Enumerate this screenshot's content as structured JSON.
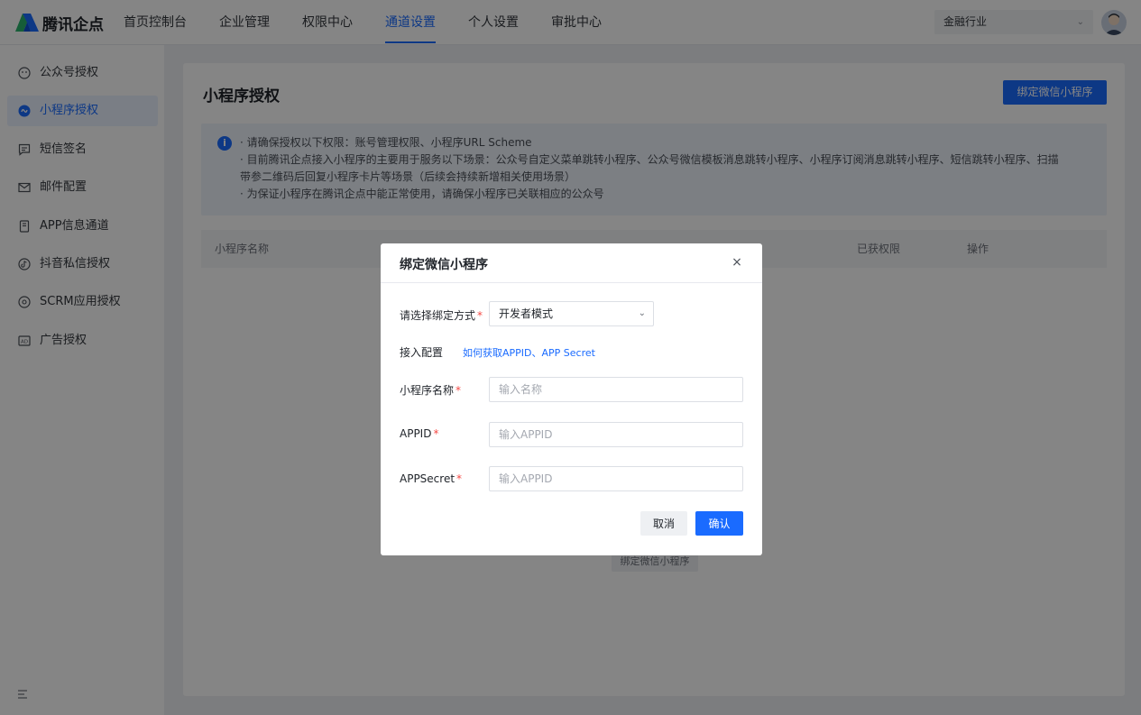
{
  "app": {
    "logo_text": "腾讯企点",
    "brand_colors": {
      "primary": "#1a6bff",
      "logo_blue": "#1a6bff",
      "logo_green": "#2bb36b"
    }
  },
  "topnav": {
    "items": [
      {
        "label": "首页控制台",
        "active": false
      },
      {
        "label": "企业管理",
        "active": false
      },
      {
        "label": "权限中心",
        "active": false
      },
      {
        "label": "通道设置",
        "active": true
      },
      {
        "label": "个人设置",
        "active": false
      },
      {
        "label": "审批中心",
        "active": false
      }
    ],
    "industry_select": {
      "value": "金融行业"
    }
  },
  "sidebar": {
    "items": [
      {
        "label": "公众号授权",
        "icon": "wechat-official-icon",
        "active": false
      },
      {
        "label": "小程序授权",
        "icon": "mini-program-icon",
        "active": true
      },
      {
        "label": "短信签名",
        "icon": "sms-icon",
        "active": false
      },
      {
        "label": "邮件配置",
        "icon": "mail-icon",
        "active": false
      },
      {
        "label": "APP信息通道",
        "icon": "app-icon",
        "active": false
      },
      {
        "label": "抖音私信授权",
        "icon": "douyin-icon",
        "active": false
      },
      {
        "label": "SCRM应用授权",
        "icon": "scrm-icon",
        "active": false
      },
      {
        "label": "广告授权",
        "icon": "ad-icon",
        "active": false
      }
    ]
  },
  "main": {
    "title": "小程序授权",
    "bind_button": "绑定微信小程序",
    "notice": {
      "icon": "info-icon",
      "lines": [
        "· 请确保授权以下权限：账号管理权限、小程序URL Scheme",
        "· 目前腾讯企点接入小程序的主要用于服务以下场景：公众号自定义菜单跳转小程序、公众号微信模板消息跳转小程序、小程序订阅消息跳转小程序、短信跳转小程序、扫描",
        "  带参二维码后回复小程序卡片等场景（后续会持续新增相关使用场景）",
        "· 为保证小程序在腾讯企点中能正常使用，请确保小程序已关联相应的公众号"
      ]
    },
    "table": {
      "columns": [
        "小程序名称",
        "已获权限",
        "操作"
      ]
    },
    "empty_bind_button": "绑定微信小程序"
  },
  "modal": {
    "title": "绑定微信小程序",
    "close_label": "×",
    "mode": {
      "label": "请选择绑定方式",
      "value": "开发者模式"
    },
    "config_label": "接入配置",
    "help_link": "如何获取APPID、APP Secret",
    "fields": {
      "name": {
        "label": "小程序名称",
        "placeholder": "输入名称"
      },
      "appid": {
        "label": "APPID",
        "placeholder": "输入APPID"
      },
      "secret": {
        "label": "APPSecret",
        "placeholder": "输入APPID"
      }
    },
    "required_mark": "*",
    "cancel": "取消",
    "confirm": "确认"
  }
}
